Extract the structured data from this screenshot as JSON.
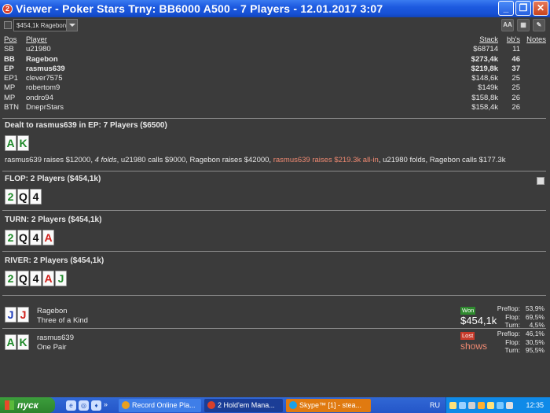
{
  "window": {
    "title": "Viewer - Poker Stars Trny: BB6000 A500 - 7 Players - 12.01.2017 3:07",
    "minimize_label": "_",
    "maximize_label": "❐",
    "close_label": "✕",
    "app_icon_glyph": "2"
  },
  "toolbar": {
    "pot_select_value": "$454,1k Ragebon",
    "font_button": "AA",
    "grid_button": "▦",
    "edit_button": "✎"
  },
  "players_table": {
    "headers": {
      "pos": "Pos",
      "player": "Player",
      "stack": "Stack",
      "bbs": "bb's",
      "notes": "Notes"
    },
    "rows": [
      {
        "pos": "SB",
        "player": "u21980",
        "stack": "$68714",
        "bbs": "11",
        "bold": false
      },
      {
        "pos": "BB",
        "player": "Ragebon",
        "stack": "$273,4k",
        "bbs": "46",
        "bold": true
      },
      {
        "pos": "EP",
        "player": "rasmus639",
        "stack": "$219,8k",
        "bbs": "37",
        "bold": true
      },
      {
        "pos": "EP1",
        "player": "clever7575",
        "stack": "$148,6k",
        "bbs": "25",
        "bold": false
      },
      {
        "pos": "MP",
        "player": "robertom9",
        "stack": "$149k",
        "bbs": "25",
        "bold": false
      },
      {
        "pos": "MP",
        "player": "ondro94",
        "stack": "$158,8k",
        "bbs": "26",
        "bold": false
      },
      {
        "pos": "BTN",
        "player": "DneprStars",
        "stack": "$158,4k",
        "bbs": "26",
        "bold": false
      }
    ]
  },
  "preflop": {
    "title": "Dealt to rasmus639 in EP: 7 Players ($6500)",
    "hole_cards": [
      {
        "rank": "A",
        "color": "#1f8a2a"
      },
      {
        "rank": "K",
        "color": "#1f8a2a"
      }
    ],
    "actions": {
      "a1": "rasmus639 raises $12000, ",
      "a2": "4 folds",
      "a3": ", u21980 calls $9000, Ragebon raises $42000, ",
      "a4": "rasmus639 raises $219.3k all-in",
      "a5": ", u21980 folds, Ragebon calls $177.3k"
    }
  },
  "flop": {
    "title": "FLOP: 2 Players ($454,1k)",
    "cards": [
      {
        "rank": "2",
        "color": "#1f8a2a"
      },
      {
        "rank": "Q",
        "color": "#111111"
      },
      {
        "rank": "4",
        "color": "#111111"
      }
    ]
  },
  "turn": {
    "title": "TURN: 2 Players ($454,1k)",
    "cards": [
      {
        "rank": "2",
        "color": "#1f8a2a"
      },
      {
        "rank": "Q",
        "color": "#111111"
      },
      {
        "rank": "4",
        "color": "#111111"
      },
      {
        "rank": "A",
        "color": "#d0201a"
      }
    ]
  },
  "river": {
    "title": "RIVER: 2 Players ($454,1k)",
    "cards": [
      {
        "rank": "2",
        "color": "#1f8a2a"
      },
      {
        "rank": "Q",
        "color": "#111111"
      },
      {
        "rank": "4",
        "color": "#111111"
      },
      {
        "rank": "A",
        "color": "#d0201a"
      },
      {
        "rank": "J",
        "color": "#1f8a2a"
      }
    ]
  },
  "results": [
    {
      "player": "Ragebon",
      "hand": "Three of a Kind",
      "cards": [
        {
          "rank": "J",
          "color": "#1a3ab8"
        },
        {
          "rank": "J",
          "color": "#d0201a"
        }
      ],
      "badge": "Won",
      "outcome_text": "$454,1k",
      "equity": [
        {
          "label": "Preflop:",
          "value": "53,9%"
        },
        {
          "label": "Flop:",
          "value": "69,5%"
        },
        {
          "label": "Turn:",
          "value": "4,5%"
        }
      ]
    },
    {
      "player": "rasmus639",
      "hand": "One Pair",
      "cards": [
        {
          "rank": "A",
          "color": "#1f8a2a"
        },
        {
          "rank": "K",
          "color": "#1f8a2a"
        }
      ],
      "badge": "Lost",
      "outcome_text": "shows",
      "equity": [
        {
          "label": "Preflop:",
          "value": "46,1%"
        },
        {
          "label": "Flop:",
          "value": "30,5%"
        },
        {
          "label": "Turn:",
          "value": "95,5%"
        }
      ]
    }
  ],
  "taskbar": {
    "start_label": "пуск",
    "quicklaunch": [
      "e",
      "◎",
      "♦"
    ],
    "quicklaunch_more": "»",
    "tasks": [
      {
        "label": "Record Online Pla...",
        "style": "normal",
        "icon_color": "#e8a020"
      },
      {
        "label": "2 Hold'em Mana...",
        "style": "active",
        "icon_color": "#d8402a"
      },
      {
        "label": "Skype™ [1] - stea...",
        "style": "skype",
        "icon_color": "#1aa0e8"
      }
    ],
    "language": "RU",
    "clock": "12:35"
  },
  "colors": {
    "background": "#3b3b3b",
    "separator": "#8a8a8a",
    "highlight_action": "#f08a72",
    "won_badge": "#2f8a2f",
    "lost_badge": "#c83a2a"
  }
}
